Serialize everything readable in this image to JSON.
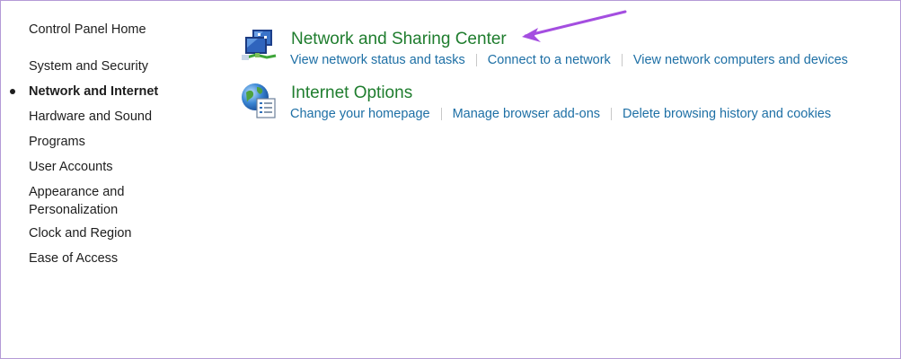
{
  "nav": {
    "home": "Control Panel Home",
    "items": [
      {
        "label": "System and Security"
      },
      {
        "label": "Network and Internet",
        "active": true
      },
      {
        "label": "Hardware and Sound"
      },
      {
        "label": "Programs"
      },
      {
        "label": "User Accounts"
      },
      {
        "label": "Appearance and"
      },
      {
        "label": "Personalization"
      },
      {
        "label": "Clock and Region"
      },
      {
        "label": "Ease of Access"
      }
    ]
  },
  "categories": [
    {
      "title": "Network and Sharing Center",
      "icon": "network-sharing-icon",
      "links": [
        "View network status and tasks",
        "Connect to a network",
        "View network computers and devices"
      ]
    },
    {
      "title": "Internet Options",
      "icon": "internet-options-icon",
      "links": [
        "Change your homepage",
        "Manage browser add-ons",
        "Delete browsing history and cookies"
      ]
    }
  ],
  "colors": {
    "category_title": "#1f7d2e",
    "link": "#1d6fa5",
    "annotation_arrow": "#a44ee0",
    "frame_border": "#b49ad6"
  }
}
